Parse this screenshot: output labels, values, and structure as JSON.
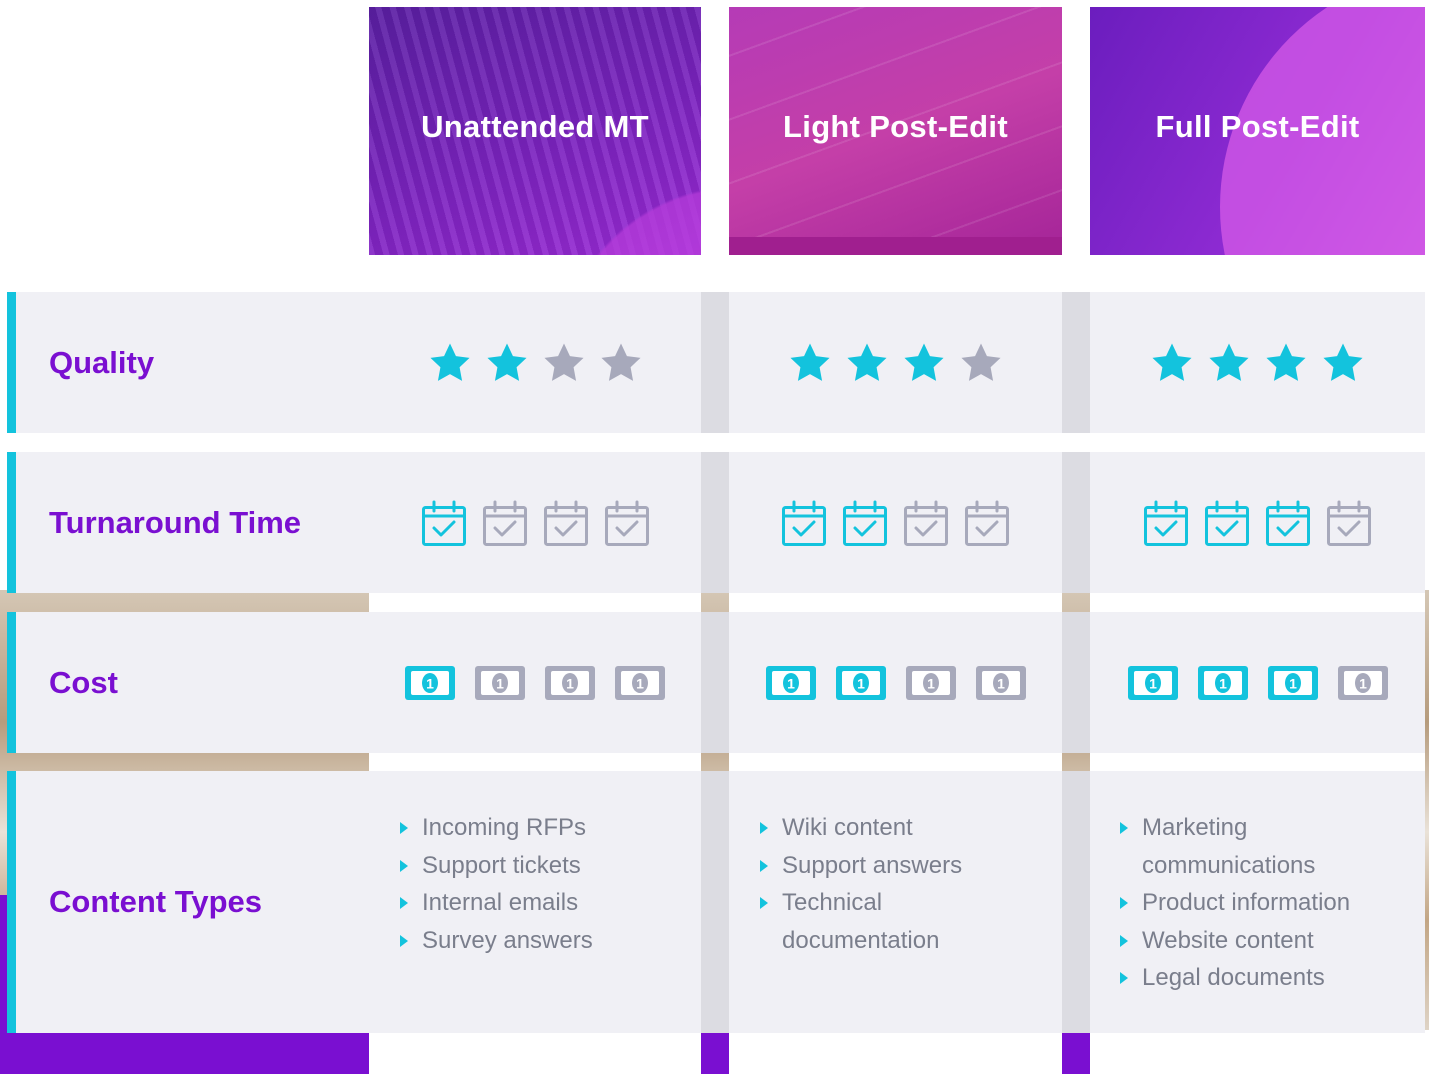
{
  "columns": [
    {
      "title": "Unattended MT",
      "quality": 2,
      "turnaround": 1,
      "cost": 1,
      "content": [
        "Incoming RFPs",
        "Support tickets",
        "Internal emails",
        "Survey answers"
      ]
    },
    {
      "title": "Light Post-Edit",
      "quality": 3,
      "turnaround": 2,
      "cost": 2,
      "content": [
        "Wiki content",
        "Support answers",
        "Technical documentation"
      ]
    },
    {
      "title": "Full Post-Edit",
      "quality": 4,
      "turnaround": 3,
      "cost": 3,
      "content": [
        "Marketing communications",
        "Product information",
        "Website content",
        "Legal documents"
      ]
    }
  ],
  "rows": {
    "quality": "Quality",
    "turnaround": "Turnaround Time",
    "cost": "Cost",
    "content": "Content Types"
  },
  "colors": {
    "accent": "#13c3dd",
    "inactive": "#a7a9bb",
    "label": "#7a0fd1"
  },
  "icons": {
    "quality": "star-icon",
    "turnaround": "calendar-check-icon",
    "cost": "dollar-bill-icon",
    "bullet": "triangle-right-icon"
  },
  "scale_max": 4
}
